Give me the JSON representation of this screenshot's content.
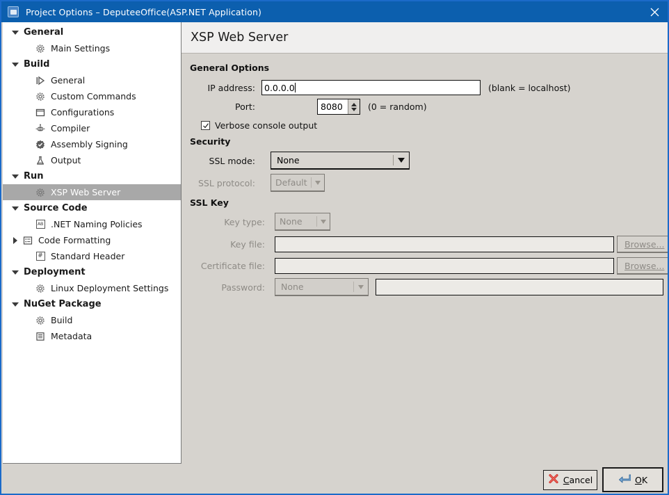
{
  "window": {
    "title": "Project Options – DeputeeOffice(ASP.NET Application)",
    "app_icon": "app-window-icon",
    "close_icon": "close-icon"
  },
  "sidebar": {
    "items": [
      {
        "label": "General",
        "level": "group",
        "expander": "chevron-down-icon",
        "icon": null
      },
      {
        "label": "Main Settings",
        "level": "child",
        "expander": null,
        "icon": "gear-icon"
      },
      {
        "label": "Build",
        "level": "group",
        "expander": "chevron-down-icon",
        "icon": null
      },
      {
        "label": "General",
        "level": "child",
        "expander": null,
        "icon": "play-icon"
      },
      {
        "label": "Custom Commands",
        "level": "child",
        "expander": null,
        "icon": "gear-icon"
      },
      {
        "label": "Configurations",
        "level": "child",
        "expander": null,
        "icon": "window-icon"
      },
      {
        "label": "Compiler",
        "level": "child",
        "expander": null,
        "icon": "robot-icon"
      },
      {
        "label": "Assembly Signing",
        "level": "child",
        "expander": null,
        "icon": "badge-check-icon"
      },
      {
        "label": "Output",
        "level": "child",
        "expander": null,
        "icon": "flask-icon"
      },
      {
        "label": "Run",
        "level": "group",
        "expander": "chevron-down-icon",
        "icon": null
      },
      {
        "label": "XSP Web Server",
        "level": "child",
        "expander": null,
        "icon": "gear-icon",
        "selected": true
      },
      {
        "label": "Source Code",
        "level": "group",
        "expander": "chevron-down-icon",
        "icon": null
      },
      {
        "label": ".NET Naming Policies",
        "level": "child",
        "expander": null,
        "icon": "ab-box-icon"
      },
      {
        "label": "Code Formatting",
        "level": "child",
        "expander": "chevron-right-icon",
        "icon": "list-box-icon"
      },
      {
        "label": "Standard Header",
        "level": "child",
        "expander": null,
        "icon": "hash-box-icon"
      },
      {
        "label": "Deployment",
        "level": "group",
        "expander": "chevron-down-icon",
        "icon": null
      },
      {
        "label": "Linux Deployment Settings",
        "level": "child",
        "expander": null,
        "icon": "gear-icon"
      },
      {
        "label": "NuGet Package",
        "level": "group",
        "expander": "chevron-down-icon",
        "icon": null
      },
      {
        "label": "Build",
        "level": "child",
        "expander": null,
        "icon": "gear-icon"
      },
      {
        "label": "Metadata",
        "level": "child",
        "expander": null,
        "icon": "document-box-icon"
      }
    ]
  },
  "panel": {
    "title": "XSP Web Server",
    "general_options": {
      "heading": "General Options",
      "ip_label": "IP address:",
      "ip_value": "0.0.0.0",
      "ip_hint": "(blank = localhost)",
      "port_label": "Port:",
      "port_value": "8080",
      "port_hint": "(0 = random)",
      "verbose_label": "Verbose console output",
      "verbose_checked": true
    },
    "security": {
      "heading": "Security",
      "ssl_mode_label": "SSL mode:",
      "ssl_mode_value": "None",
      "ssl_protocol_label": "SSL protocol:",
      "ssl_protocol_value": "Default"
    },
    "ssl_key": {
      "heading": "SSL Key",
      "key_type_label": "Key type:",
      "key_type_value": "None",
      "key_file_label": "Key file:",
      "key_file_value": "",
      "key_file_browse": "Browse...",
      "cert_file_label": "Certificate file:",
      "cert_file_value": "",
      "cert_file_browse": "Browse...",
      "password_label": "Password:",
      "password_mode_value": "None",
      "password_value": ""
    }
  },
  "actions": {
    "cancel_label": "Cancel",
    "cancel_accel": "C",
    "cancel_icon": "red-x-icon",
    "ok_label": "OK",
    "ok_accel": "O",
    "ok_icon": "enter-arrow-icon"
  },
  "colors": {
    "titlebar": "#0c5fae",
    "dialog_border": "#1b6ac9",
    "panel_bg": "#d6d3ce",
    "header_bg": "#f0efee",
    "selection": "#a8a8a8",
    "cancel_icon": "#d0342c",
    "ok_icon": "#5a8fc8"
  }
}
